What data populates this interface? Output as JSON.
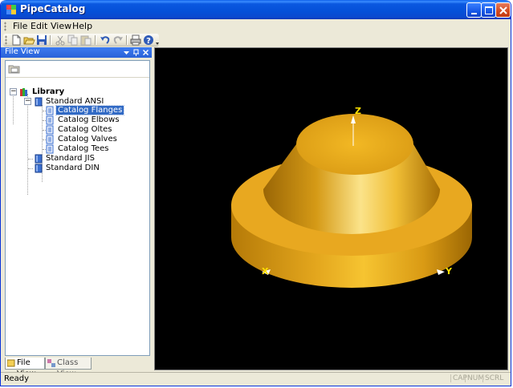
{
  "window": {
    "title": "PipeCatalog"
  },
  "menu": {
    "items": [
      "File",
      "Edit",
      "View",
      "Help"
    ]
  },
  "toolbar": {
    "icons": [
      "new-icon",
      "open-icon",
      "save-icon",
      "cut-icon",
      "copy-icon",
      "paste-icon",
      "undo-icon",
      "redo-icon",
      "print-icon",
      "help-icon"
    ]
  },
  "file_view": {
    "title": "File View",
    "tree": {
      "root": "Library",
      "groups": [
        {
          "label": "Standard ANSI",
          "children": [
            "Catalog Flanges",
            "Catalog Elbows",
            "Catalog Oltes",
            "Catalog Valves",
            "Catalog Tees"
          ]
        },
        {
          "label": "Standard JIS"
        },
        {
          "label": "Standard DIN"
        }
      ],
      "selected": "Catalog Flanges"
    },
    "tabs": [
      "File View",
      "Class View"
    ]
  },
  "viewport": {
    "axes": [
      "Z",
      "X",
      "Y"
    ],
    "model_color": "#e8a820"
  },
  "status": {
    "text": "Ready",
    "indicators": [
      "CAP",
      "NUM",
      "SCRL"
    ]
  },
  "colors": {
    "title_bar": "#0a58e0",
    "selection": "#316ac5",
    "viewport_bg": "#000000"
  }
}
